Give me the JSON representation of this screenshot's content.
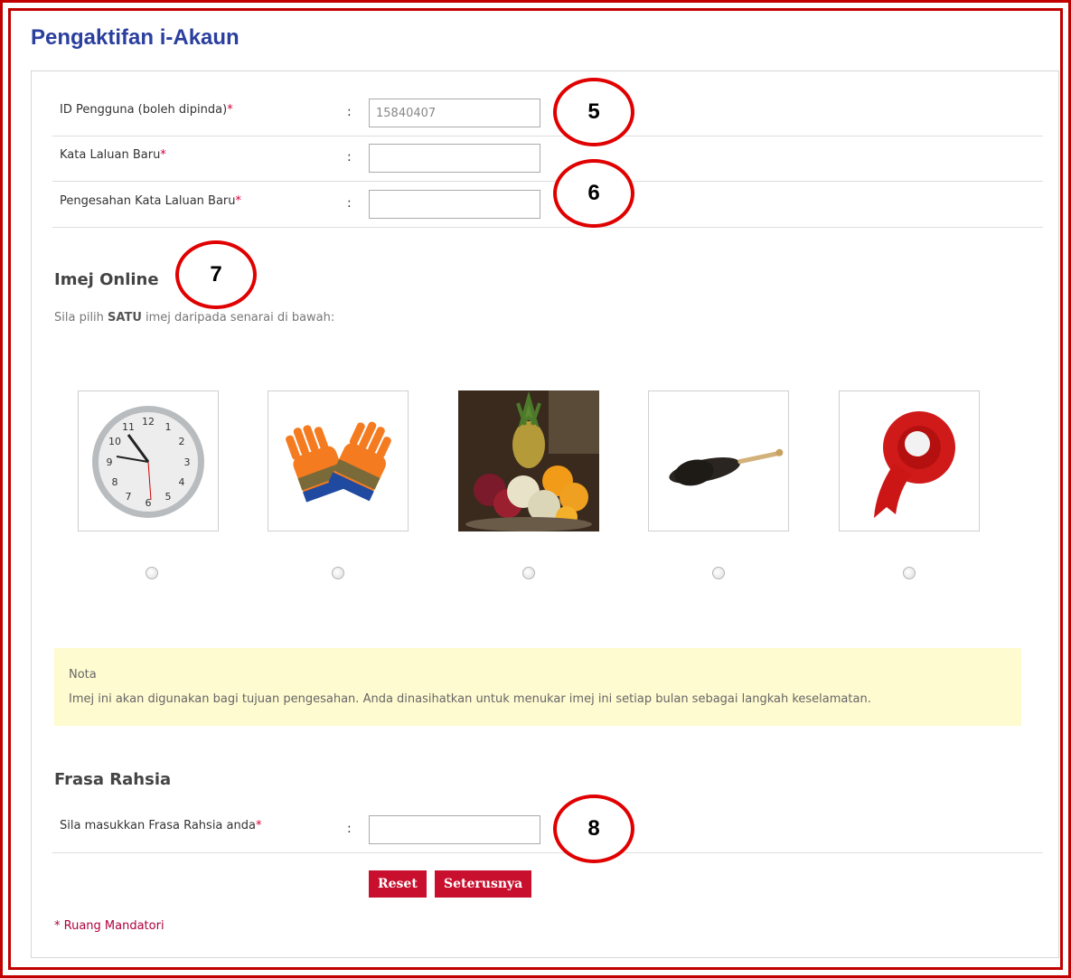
{
  "page_title": "Pengaktifan i-Akaun",
  "form": {
    "fields": [
      {
        "label": "ID Pengguna (boleh dipinda)",
        "required_mark": "*",
        "colon": ":",
        "value": "15840407"
      },
      {
        "label": "Kata Laluan Baru",
        "required_mark": "*",
        "colon": ":",
        "value": ""
      },
      {
        "label": "Pengesahan Kata Laluan Baru",
        "required_mark": "*",
        "colon": ":",
        "value": ""
      }
    ]
  },
  "online_image": {
    "heading": "Imej Online",
    "instruction_prefix": "Sila pilih",
    "instruction_bold": "SATU",
    "instruction_suffix": "imej daripada senarai di bawah:",
    "images": [
      {
        "name": "clock-image"
      },
      {
        "name": "gloves-image"
      },
      {
        "name": "fruit-basket-image"
      },
      {
        "name": "feather-duster-image"
      },
      {
        "name": "ribbon-image"
      }
    ]
  },
  "note": {
    "title": "Nota",
    "text": "Imej ini akan digunakan bagi tujuan pengesahan. Anda dinasihatkan untuk menukar imej ini setiap bulan sebagai langkah keselamatan."
  },
  "secret_phrase": {
    "heading": "Frasa Rahsia",
    "label": "Sila masukkan Frasa Rahsia anda",
    "required_mark": "*",
    "colon": ":",
    "value": ""
  },
  "buttons": {
    "reset": "Reset",
    "next": "Seterusnya"
  },
  "mandatory_note": "* Ruang Mandatori",
  "callouts": [
    "5",
    "6",
    "7",
    "8"
  ],
  "colors": {
    "title": "#2a3f9e",
    "accent": "#c8102e",
    "frame": "#c00000",
    "note_bg": "#fffbd0"
  }
}
